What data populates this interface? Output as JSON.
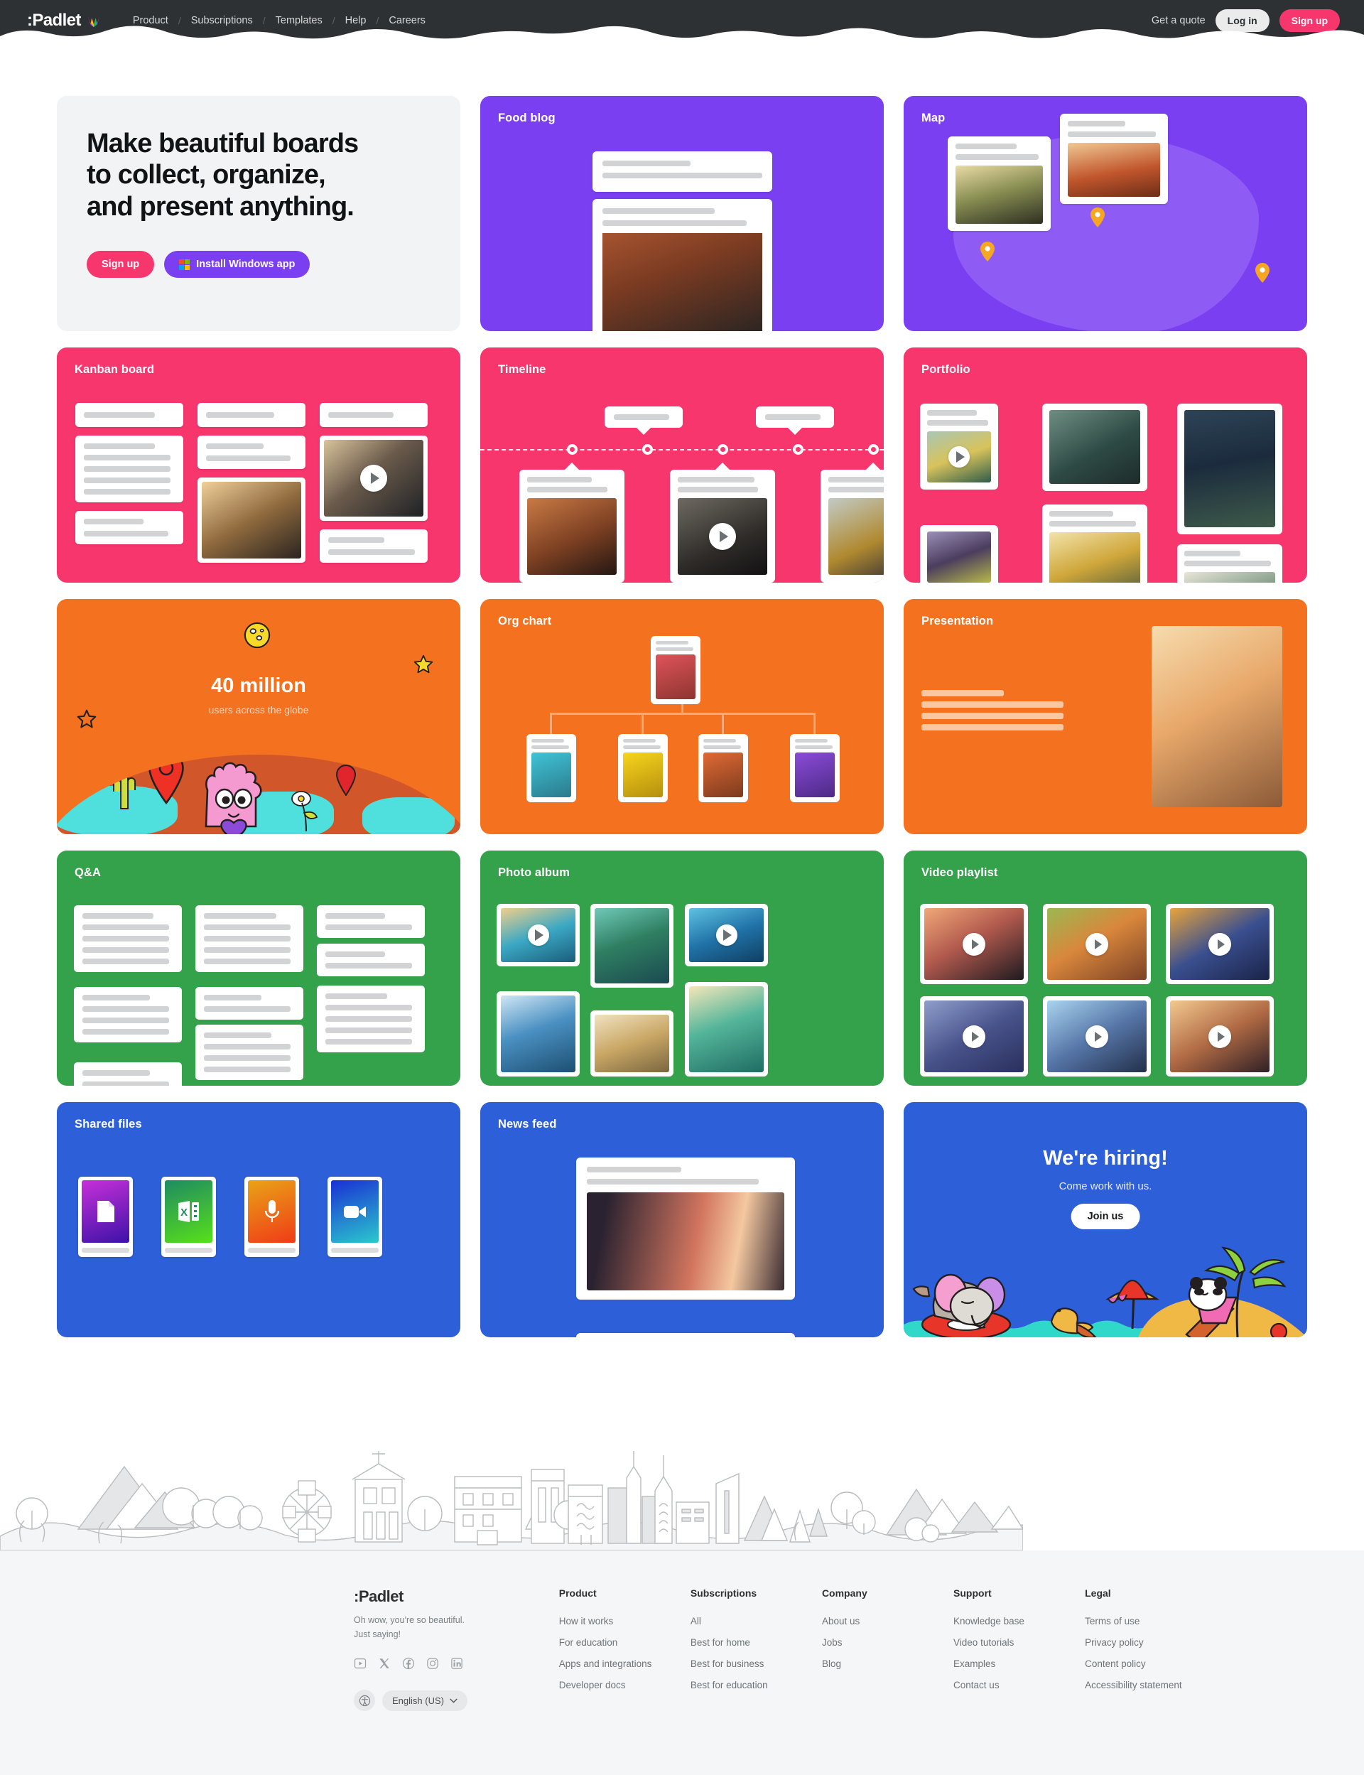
{
  "header": {
    "logo_text": ":Padlet",
    "nav": [
      {
        "label": "Product"
      },
      {
        "label": "Subscriptions"
      },
      {
        "label": "Templates"
      },
      {
        "label": "Help"
      },
      {
        "label": "Careers"
      }
    ],
    "quote_link": "Get a quote",
    "login_label": "Log in",
    "signup_label": "Sign up",
    "bg_color": "#2e3133"
  },
  "hero": {
    "headline_line1": "Make beautiful boards",
    "headline_line2": "to collect, organize,",
    "headline_line3": "and present anything.",
    "signup_label": "Sign up",
    "install_label": "Install Windows app",
    "signup_color": "#f6366c",
    "install_color": "#7b3ff2"
  },
  "cards": {
    "food_blog": {
      "title": "Food blog",
      "color": "#7b3ff2"
    },
    "map": {
      "title": "Map",
      "color": "#7b3ff2"
    },
    "kanban": {
      "title": "Kanban board",
      "color": "#f6366c"
    },
    "timeline": {
      "title": "Timeline",
      "color": "#f6366c"
    },
    "portfolio": {
      "title": "Portfolio",
      "color": "#f6366c"
    },
    "org_chart": {
      "title": "Org chart",
      "color": "#f4711f"
    },
    "presentation": {
      "title": "Presentation",
      "color": "#f4711f"
    },
    "qa": {
      "title": "Q&A",
      "color": "#33a24b"
    },
    "photo_album": {
      "title": "Photo album",
      "color": "#33a24b"
    },
    "video_playlist": {
      "title": "Video playlist",
      "color": "#33a24b"
    },
    "shared_files": {
      "title": "Shared files",
      "color": "#2d5fd8"
    },
    "news_feed": {
      "title": "News feed",
      "color": "#2d5fd8"
    }
  },
  "stat_card": {
    "number": "40 million",
    "subtitle": "users across the globe",
    "color": "#f4711f"
  },
  "hiring_card": {
    "title": "We're hiring!",
    "subtitle": "Come work with us.",
    "button_label": "Join us",
    "color": "#2d5fd8"
  },
  "footer": {
    "logo_text": ":Padlet",
    "tagline_line1": "Oh wow, you're so beautiful.",
    "tagline_line2": "Just saying!",
    "language": "English (US)",
    "social": [
      "youtube-icon",
      "x-twitter-icon",
      "facebook-icon",
      "instagram-icon",
      "linkedin-icon"
    ],
    "columns": [
      {
        "heading": "Product",
        "links": [
          "How it works",
          "For education",
          "Apps and integrations",
          "Developer docs"
        ]
      },
      {
        "heading": "Subscriptions",
        "links": [
          "All",
          "Best for home",
          "Best for business",
          "Best for education"
        ]
      },
      {
        "heading": "Company",
        "links": [
          "About us",
          "Jobs",
          "Blog"
        ]
      },
      {
        "heading": "Support",
        "links": [
          "Knowledge base",
          "Video tutorials",
          "Examples",
          "Contact us"
        ]
      },
      {
        "heading": "Legal",
        "links": [
          "Terms of use",
          "Privacy policy",
          "Content policy",
          "Accessibility statement"
        ]
      }
    ]
  }
}
